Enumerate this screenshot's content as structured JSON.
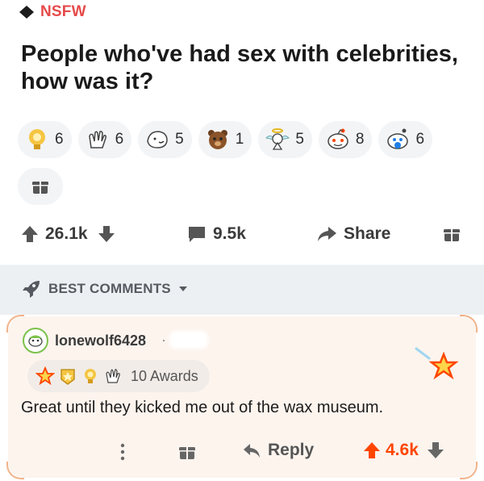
{
  "post": {
    "nsfw_label": "NSFW",
    "title": "People who've had sex with celebrities, how was it?",
    "awards": [
      {
        "icon": "gold-trophy-award-icon",
        "count": "6"
      },
      {
        "icon": "clapping-hands-award-icon",
        "count": "6"
      },
      {
        "icon": "face-award-icon",
        "count": "5"
      },
      {
        "icon": "bear-award-icon",
        "count": "1"
      },
      {
        "icon": "angel-award-icon",
        "count": "5"
      },
      {
        "icon": "snoo-face-award-icon",
        "count": "8"
      },
      {
        "icon": "snoo-hug-award-icon",
        "count": "6"
      }
    ],
    "upvotes": "26.1k",
    "comments": "9.5k",
    "share_label": "Share"
  },
  "comments_section": {
    "sort_label": "BEST COMMENTS"
  },
  "comment": {
    "username": "lonewolf6428",
    "separator": "·",
    "awards_label": "10 Awards",
    "body": "Great until they kicked me out of the wax museum.",
    "reply_label": "Reply",
    "score": "4.6k"
  },
  "colors": {
    "accent": "#ff4500",
    "nsfw": "#e64a4a",
    "comment_bg": "#fdf4ee",
    "best_bar_bg": "#edf0f3"
  }
}
